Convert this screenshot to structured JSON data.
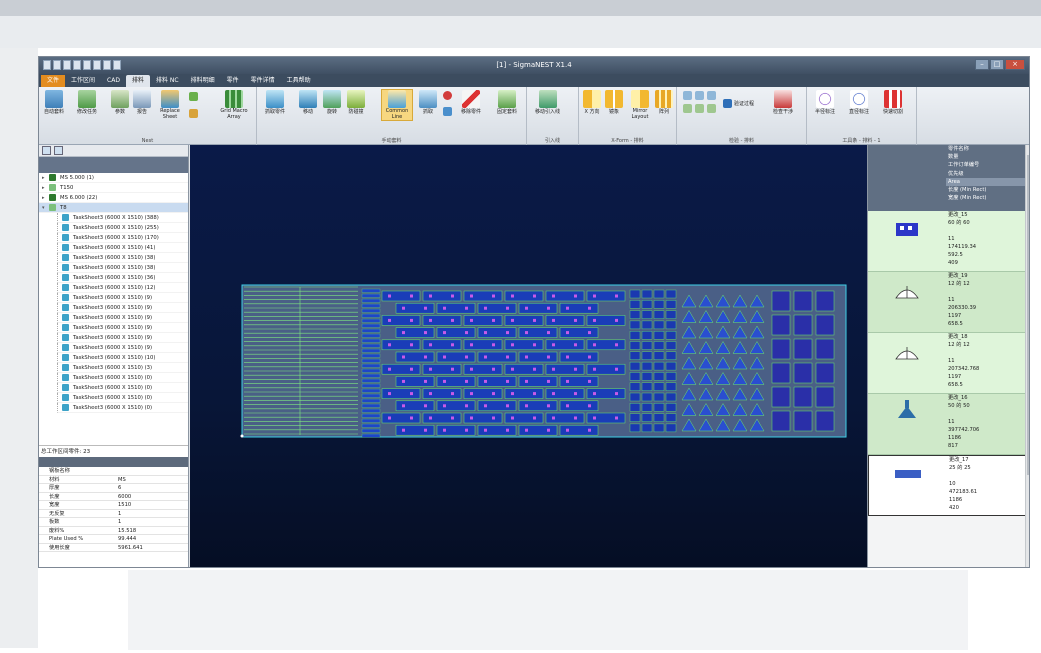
{
  "window": {
    "title": "[1] - SigmaNEST X1.4"
  },
  "tabs": [
    "文件",
    "工作区间",
    "CAD",
    "排料",
    "排料 NC",
    "排料明细",
    "零件",
    "零件详情",
    "工具帮助"
  ],
  "ribbon": {
    "nest_group": {
      "buttons": [
        "自动套料",
        "修改任务",
        "参数",
        "报告",
        "Replace Sheet",
        "Grid Macro Array"
      ],
      "label": "Nest"
    },
    "manual_group": {
      "buttons": [
        "抓取零件",
        "移动",
        "旋转",
        "防碰撞",
        "Common Line",
        "抓取",
        "移除零件",
        "固定套料"
      ],
      "active": "Common Line",
      "label": "手动套料"
    },
    "leadin_group": {
      "buttons": [
        "移动引入线"
      ],
      "label": "引入线"
    },
    "xform_group": {
      "buttons": [
        "X 方向",
        "镜象",
        "Mirror Layout",
        "阵列"
      ],
      "label": "X-Form - 排料"
    },
    "check_group": {
      "buttons": [
        "验证过程",
        "检查干涉"
      ],
      "label": "检验 - 排料"
    },
    "tools_group": {
      "buttons": [
        "半径标注",
        "直径标注",
        "快速切割"
      ],
      "label": "工具条 - 排料 - 1"
    }
  },
  "tree": {
    "groups": [
      "MS 5.000 (1)",
      "T150",
      "MS 6.000 (22)",
      "T8"
    ],
    "sheets": [
      "TaskSheet3 (6000 X 1510) (388)",
      "TaskSheet3 (6000 X 1510) (255)",
      "TaskSheet3 (6000 X 1510) (170)",
      "TaskSheet3 (6000 X 1510) (41)",
      "TaskSheet3 (6000 X 1510) (38)",
      "TaskSheet3 (6000 X 1510) (38)",
      "TaskSheet3 (6000 X 1510) (36)",
      "TaskSheet3 (6000 X 1510) (12)",
      "TaskSheet3 (6000 X 1510) (9)",
      "TaskSheet3 (6000 X 1510) (9)",
      "TaskSheet3 (6000 X 1510) (9)",
      "TaskSheet3 (6000 X 1510) (9)",
      "TaskSheet3 (6000 X 1510) (9)",
      "TaskSheet3 (6000 X 1510) (9)",
      "TaskSheet3 (6000 X 1510) (10)",
      "TaskSheet3 (6000 X 1510) (3)",
      "TaskSheet3 (6000 X 1510) (0)",
      "TaskSheet3 (6000 X 1510) (0)",
      "TaskSheet3 (6000 X 1510) (0)",
      "TaskSheet3 (6000 X 1510) (0)"
    ]
  },
  "total_label": "总工作区间零件: 23",
  "props": [
    {
      "k": "钢板名称",
      "v": ""
    },
    {
      "k": "材料",
      "v": "MS"
    },
    {
      "k": "厚度",
      "v": "6"
    },
    {
      "k": "长度",
      "v": "6000"
    },
    {
      "k": "宽度",
      "v": "1510"
    },
    {
      "k": "无反复",
      "v": "1"
    },
    {
      "k": "板数",
      "v": "1"
    },
    {
      "k": "废料%",
      "v": "15.518"
    },
    {
      "k": "Plate Used %",
      "v": "99.444"
    },
    {
      "k": "使用长度",
      "v": "5961.641"
    }
  ],
  "part_fields": [
    "零件名称",
    "数量",
    "工作订单编号",
    "优先级",
    "Area",
    "长度 (Min Rect)",
    "宽度 (Min Rect)"
  ],
  "parts": [
    {
      "name": "更改_15",
      "size": "60 的 60",
      "qty": "11",
      "area": "174119.34",
      "len": "592.5",
      "wid": "409"
    },
    {
      "name": "更改_19",
      "size": "12 的 12",
      "qty": "11",
      "area": "206330.39",
      "len": "1197",
      "wid": "658.5"
    },
    {
      "name": "更改_18",
      "size": "12 的 12",
      "qty": "11",
      "area": "207342.768",
      "len": "1197",
      "wid": "658.5"
    },
    {
      "name": "更改_16",
      "size": "50 的 50",
      "qty": "11",
      "area": "397742.706",
      "len": "1186",
      "wid": "817"
    },
    {
      "name": "更改_17",
      "size": "25 的 25",
      "qty": "10",
      "area": "472183.61",
      "len": "1186",
      "wid": "420"
    }
  ],
  "colors": {
    "accent": "#e38c1f",
    "canvas": "#0a1a48",
    "part_green": "#d9f5d4",
    "nest_blue": "#1a3db8",
    "outline": "#3fd0e8"
  }
}
